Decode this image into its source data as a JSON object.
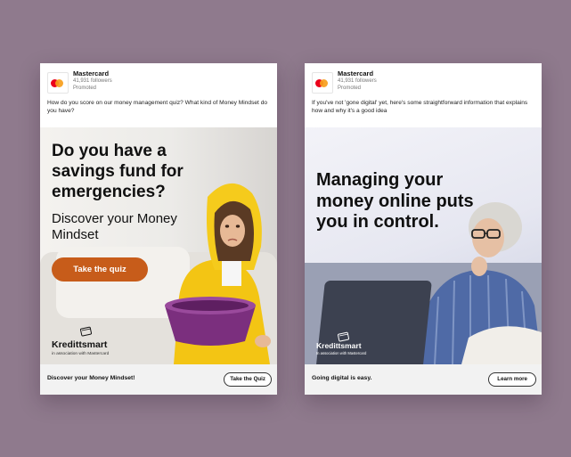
{
  "ads": [
    {
      "brand": "Mastercard",
      "followers": "41,931 followers",
      "promoted": "Promoted",
      "caption": "How do you score on our money management quiz? What kind of Money Mindset do you have?",
      "headline": "Do you have a savings fund for emergencies?",
      "subheadline": "Discover your Money Mindset",
      "creative_button": "Take the quiz",
      "partner_logo": "Kredittsmart",
      "partner_tagline": "in association with Mastercard",
      "footer_text": "Discover your Money Mindset!",
      "cta_label": "Take the Quiz"
    },
    {
      "brand": "Mastercard",
      "followers": "41,931 followers",
      "promoted": "Promoted",
      "caption": "If you've not 'gone digital' yet, here's some straightforward information that explains how and why it's a good idea",
      "headline": "Managing your money online puts you in control.",
      "partner_logo": "Kredittsmart",
      "partner_tagline": "In association with Mastercard",
      "footer_text": "Going digital is easy.",
      "cta_label": "Learn more"
    }
  ],
  "colors": {
    "backdrop": "#8f7a8d",
    "quiz_button": "#c75c1a",
    "raincoat": "#f3c514",
    "bucket": "#7b2f7e",
    "mastercard_red": "#eb001b",
    "mastercard_orange": "#f79e1b"
  },
  "icons": {
    "brand_logo": "mastercard-logo",
    "partner_icon": "card-outline-icon"
  }
}
